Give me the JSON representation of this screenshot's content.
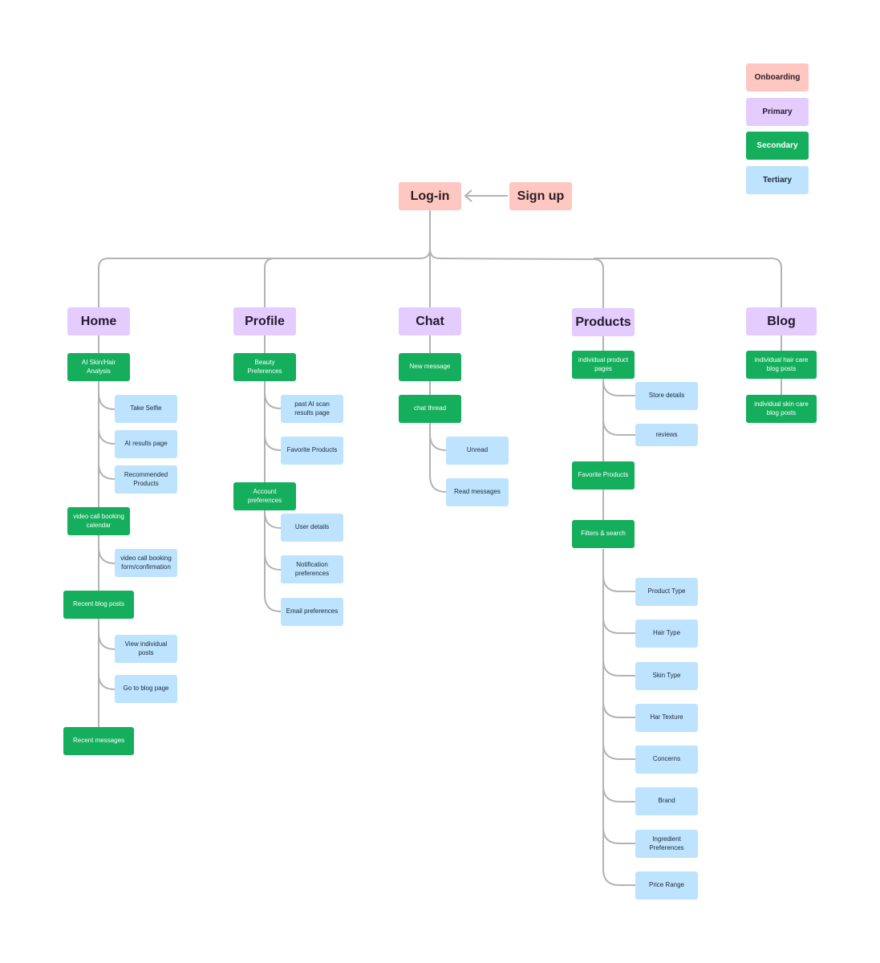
{
  "legend": {
    "items": [
      {
        "label": "Onboarding",
        "color": "#ffc7c2"
      },
      {
        "label": "Primary",
        "color": "#e4ccff"
      },
      {
        "label": "Secondary",
        "color": "#14ae5c"
      },
      {
        "label": "Tertiary",
        "color": "#bde3ff"
      }
    ]
  },
  "onboarding": {
    "login": "Log-in",
    "signup": "Sign up"
  },
  "sections": {
    "home": {
      "title": "Home",
      "children": [
        {
          "label": "AI Skin/Hair Analysis",
          "children": [
            "Take Selfie",
            "AI results page",
            "Recommended Products"
          ]
        },
        {
          "label": "video call booking calendar",
          "children": [
            "video call booking form/confirmation"
          ]
        },
        {
          "label": "Recent blog posts",
          "children": [
            "View individual posts",
            "Go to blog page"
          ]
        },
        {
          "label": "Recent messages",
          "children": []
        }
      ]
    },
    "profile": {
      "title": "Profile",
      "children": [
        {
          "label": "Beauty Preferences",
          "children": [
            "past AI scan results page",
            "Favorite Products"
          ]
        },
        {
          "label": "Account preferences",
          "children": [
            "User details",
            "Notification preferences",
            "Email preferences"
          ]
        }
      ]
    },
    "chat": {
      "title": "Chat",
      "children": [
        {
          "label": "New message",
          "children": []
        },
        {
          "label": "chat thread",
          "children": [
            "Unread",
            "Read messages"
          ]
        }
      ]
    },
    "products": {
      "title": "Products",
      "children": [
        {
          "label": "individual product pages",
          "children": [
            "Store details",
            "reviews"
          ]
        },
        {
          "label": "Favorite Products",
          "children": []
        },
        {
          "label": "Filters & search",
          "children": [
            "Product Type",
            "Hair Type",
            "Skin Type",
            "Har Texture",
            "Concerns",
            "Brand",
            "Ingredient Preferences",
            "Price Range"
          ]
        }
      ]
    },
    "blog": {
      "title": "Blog",
      "children": [
        {
          "label": "individual hair care blog posts",
          "children": []
        },
        {
          "label": "individual skin care blog posts",
          "children": []
        }
      ]
    }
  }
}
